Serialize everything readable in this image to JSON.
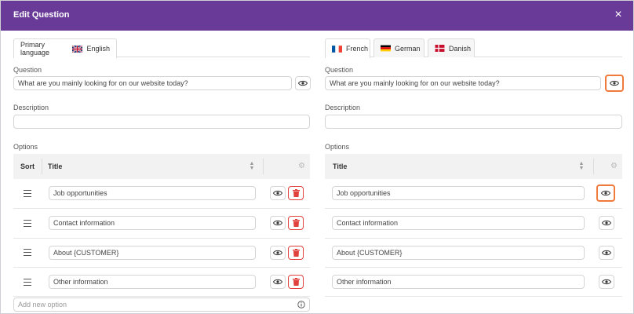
{
  "header": {
    "title": "Edit Question",
    "close_label": "×"
  },
  "left": {
    "tab": {
      "prefix": "Primary language",
      "language": "English"
    },
    "question_label": "Question",
    "question_value": "What are you mainly looking for on our website today?",
    "description_label": "Description",
    "description_value": "",
    "options_label": "Options",
    "table_headers": {
      "sort": "Sort",
      "title": "Title"
    },
    "options": [
      "Job opportunities",
      "Contact information",
      "About {CUSTOMER}",
      "Other information"
    ],
    "add_placeholder": "Add new option"
  },
  "right": {
    "tabs": [
      "French",
      "German",
      "Danish"
    ],
    "question_label": "Question",
    "question_value": "What are you mainly looking for on our website today?",
    "description_label": "Description",
    "description_value": "",
    "options_label": "Options",
    "table_headers": {
      "title": "Title"
    },
    "options": [
      "Job opportunities",
      "Contact information",
      "About {CUSTOMER}",
      "Other information"
    ]
  },
  "icons": {
    "eye": "eye-icon",
    "trash": "trash-icon",
    "gear": "gear-icon",
    "info": "info-icon",
    "drag": "drag-handle-icon",
    "sort": "sort-icon",
    "close": "close-icon"
  },
  "colors": {
    "header": "#6a3a98",
    "highlight": "#ef7a3a",
    "delete": "#e0413c"
  }
}
